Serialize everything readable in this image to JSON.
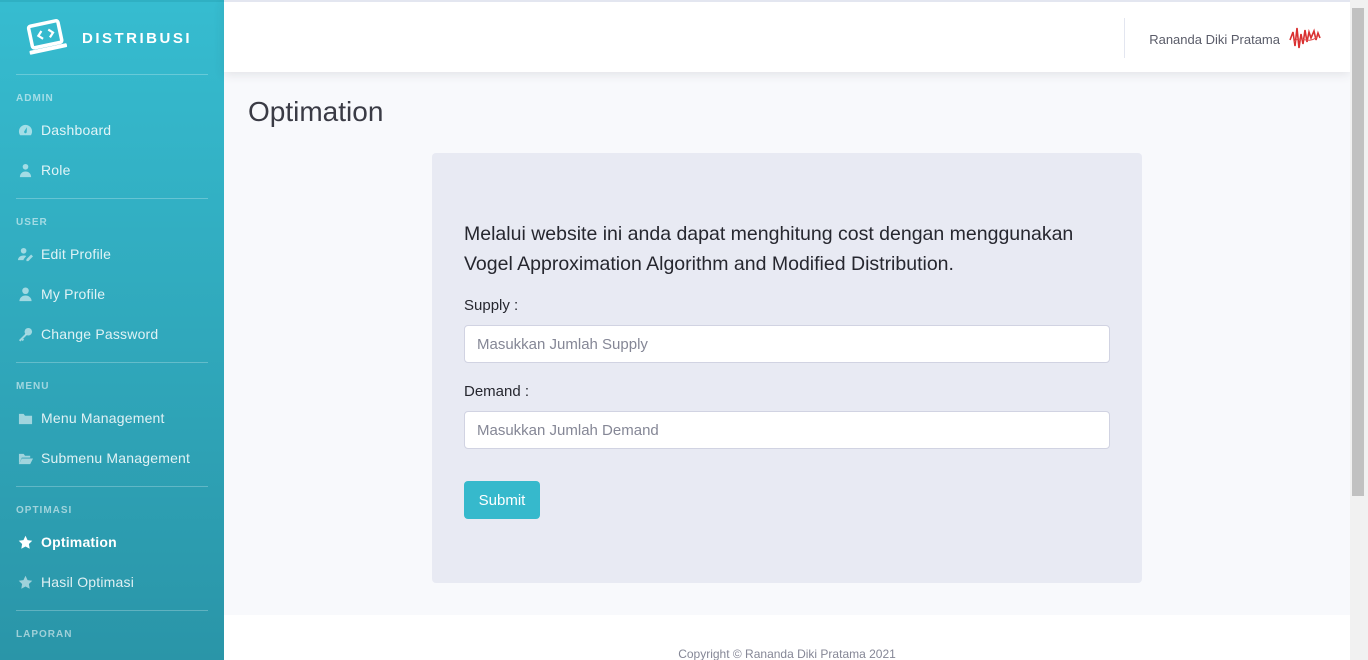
{
  "brand": {
    "name": "DISTRIBUSI",
    "icon": "laptop-code-icon"
  },
  "sidebar": {
    "sections": [
      {
        "heading": "ADMIN",
        "items": [
          {
            "label": "Dashboard",
            "icon": "tachometer-icon"
          },
          {
            "label": "Role",
            "icon": "user-tie-icon"
          }
        ]
      },
      {
        "heading": "USER",
        "items": [
          {
            "label": "Edit Profile",
            "icon": "user-edit-icon"
          },
          {
            "label": "My Profile",
            "icon": "user-icon"
          },
          {
            "label": "Change Password",
            "icon": "key-icon"
          }
        ]
      },
      {
        "heading": "MENU",
        "items": [
          {
            "label": "Menu Management",
            "icon": "folder-icon"
          },
          {
            "label": "Submenu Management",
            "icon": "folder-open-icon"
          }
        ]
      },
      {
        "heading": "OPTIMASI",
        "items": [
          {
            "label": "Optimation",
            "icon": "star-icon",
            "active": true
          },
          {
            "label": "Hasil Optimasi",
            "icon": "star-icon"
          }
        ]
      },
      {
        "heading": "LAPORAN",
        "items": []
      }
    ]
  },
  "topbar": {
    "user_name": "Rananda Diki Pratama"
  },
  "page": {
    "title": "Optimation",
    "intro": "Melalui website ini anda dapat menghitung cost dengan menggunakan Vogel Approximation Algorithm and Modified Distribution.",
    "supply_label": "Supply :",
    "supply_placeholder": "Masukkan Jumlah Supply",
    "demand_label": "Demand :",
    "demand_placeholder": "Masukkan Jumlah Demand",
    "submit_label": "Submit"
  },
  "footer": {
    "copyright": "Copyright © Rananda Diki Pratama 2021"
  },
  "colors": {
    "sidebar_top": "#36bcd0",
    "sidebar_bottom": "#2a95a8",
    "accent": "#36b9cc",
    "card_bg": "#e8eaf3",
    "page_bg": "#f8f9fc"
  }
}
